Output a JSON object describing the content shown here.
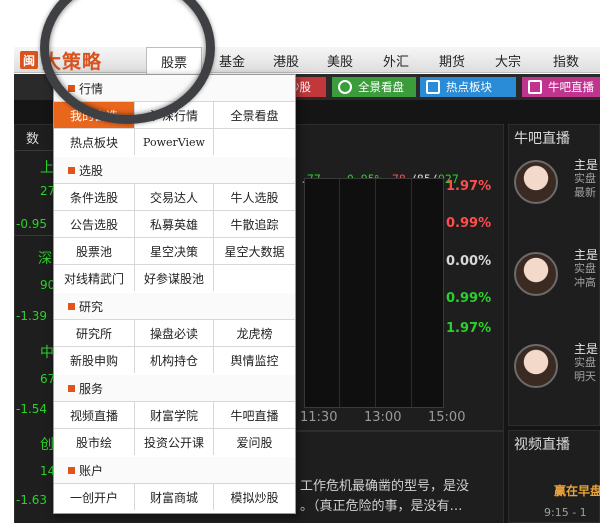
{
  "logo": {
    "mark": "闽",
    "name": "大策略"
  },
  "topnav": [
    "股票",
    "基金",
    "港股",
    "美股",
    "外汇",
    "期货",
    "大宗",
    "指数"
  ],
  "toolbar": {
    "partial_left": "炒股",
    "panorama": "全景看盘",
    "hot": "热点板块",
    "niuba": "牛吧直播"
  },
  "menu": {
    "sections": [
      {
        "title": "行情",
        "items": [
          "我的自选",
          "沪深行情",
          "全景看盘",
          "热点板块",
          "PowerView",
          ""
        ]
      },
      {
        "title": "选股",
        "items": [
          "条件选股",
          "交易达人",
          "牛人选股",
          "公告选股",
          "私募英雄",
          "牛散追踪",
          "股票池",
          "星空决策",
          "星空大数据",
          "对线精武门",
          "好参谋股池",
          ""
        ]
      },
      {
        "title": "研究",
        "items": [
          "研究所",
          "操盘必读",
          "龙虎榜",
          "新股申购",
          "机构持仓",
          "舆情监控"
        ]
      },
      {
        "title": "服务",
        "items": [
          "视频直播",
          "财富学院",
          "牛吧直播",
          "股市绘",
          "投资公开课",
          "爱问股"
        ]
      },
      {
        "title": "账户",
        "items": [
          "一创开户",
          "财富商城",
          "模拟炒股"
        ]
      }
    ]
  },
  "chart": {
    "header": {
      "a": ".77",
      "b": "-0.95%",
      "c": "78",
      "d": "/85/",
      "e": "927"
    },
    "pcts": [
      "1.97%",
      "0.99%",
      "0.00%",
      "0.99%",
      "1.97%"
    ],
    "times": [
      "11:30",
      "13:00",
      "15:00"
    ]
  },
  "left": {
    "labels": [
      "上",
      "深",
      "中",
      "创"
    ],
    "values": [
      "27",
      "90",
      "67",
      "14"
    ],
    "changes": [
      "-0.95",
      "-1.39",
      "-1.54",
      "-1.63"
    ],
    "top": "数"
  },
  "right": {
    "niuba_title": "牛吧直播",
    "video_title": "视频直播",
    "entries": [
      {
        "t": "主是",
        "a": "实盘",
        "b": "最新"
      },
      {
        "t": "主是",
        "a": "实盘",
        "b": "冲高"
      },
      {
        "t": "主是",
        "a": "实盘",
        "b": "明天"
      }
    ],
    "video_a": "赢在早盘",
    "video_b": "9:15 - 1"
  },
  "news": [
    "工作危机最确凿的型号，是没",
    "。（真正危险的事，是没有…"
  ],
  "colors": {
    "accent": "#e9661d",
    "up": "#ff4d4d",
    "down": "#2bd02b",
    "dark": "#151515"
  }
}
